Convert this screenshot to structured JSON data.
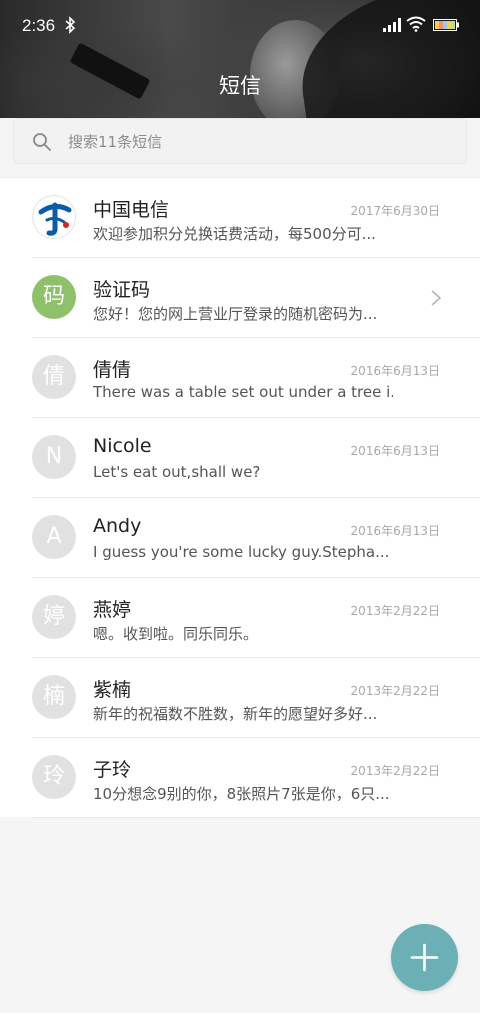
{
  "status_bar": {
    "time": "2:36"
  },
  "header": {
    "title": "短信"
  },
  "search": {
    "placeholder": "搜索11条短信"
  },
  "conversations": [
    {
      "name": "中国电信",
      "preview": "欢迎参加积分兑换话费活动，每500分可...",
      "date": "2017年6月30日",
      "avatar": "telecom-logo"
    },
    {
      "name": "验证码",
      "preview": "您好！您的网上营业厅登录的随机密码为...",
      "date": "",
      "avatar_text": "码"
    },
    {
      "name": "倩倩",
      "preview": "There was a table set out under a tree i...",
      "date": "2016年6月13日",
      "avatar_text": "倩"
    },
    {
      "name": "Nicole",
      "preview": "Let's eat out,shall we?",
      "date": "2016年6月13日",
      "avatar_text": "N"
    },
    {
      "name": "Andy",
      "preview": "I guess you're some lucky guy.Stepha...",
      "date": "2016年6月13日",
      "avatar_text": "A"
    },
    {
      "name": "燕婷",
      "preview": "嗯。收到啦。同乐同乐。",
      "date": "2013年2月22日",
      "avatar_text": "婷"
    },
    {
      "name": "紫楠",
      "preview": "新年的祝福数不胜数，新年的愿望好多好...",
      "date": "2013年2月22日",
      "avatar_text": "楠"
    },
    {
      "name": "子玲",
      "preview": "10分想念9别的你，8张照片7张是你，6只...",
      "date": "2013年2月22日",
      "avatar_text": "玲"
    }
  ],
  "colors": {
    "accent": "#6ab0b4",
    "green_avatar": "#8fc16a",
    "gray_avatar": "#e1e1e1",
    "telecom_blue": "#0a5ba8"
  },
  "icons": {
    "fab": "plus-icon",
    "search": "search-icon",
    "row_action": "chevron-right-icon"
  }
}
